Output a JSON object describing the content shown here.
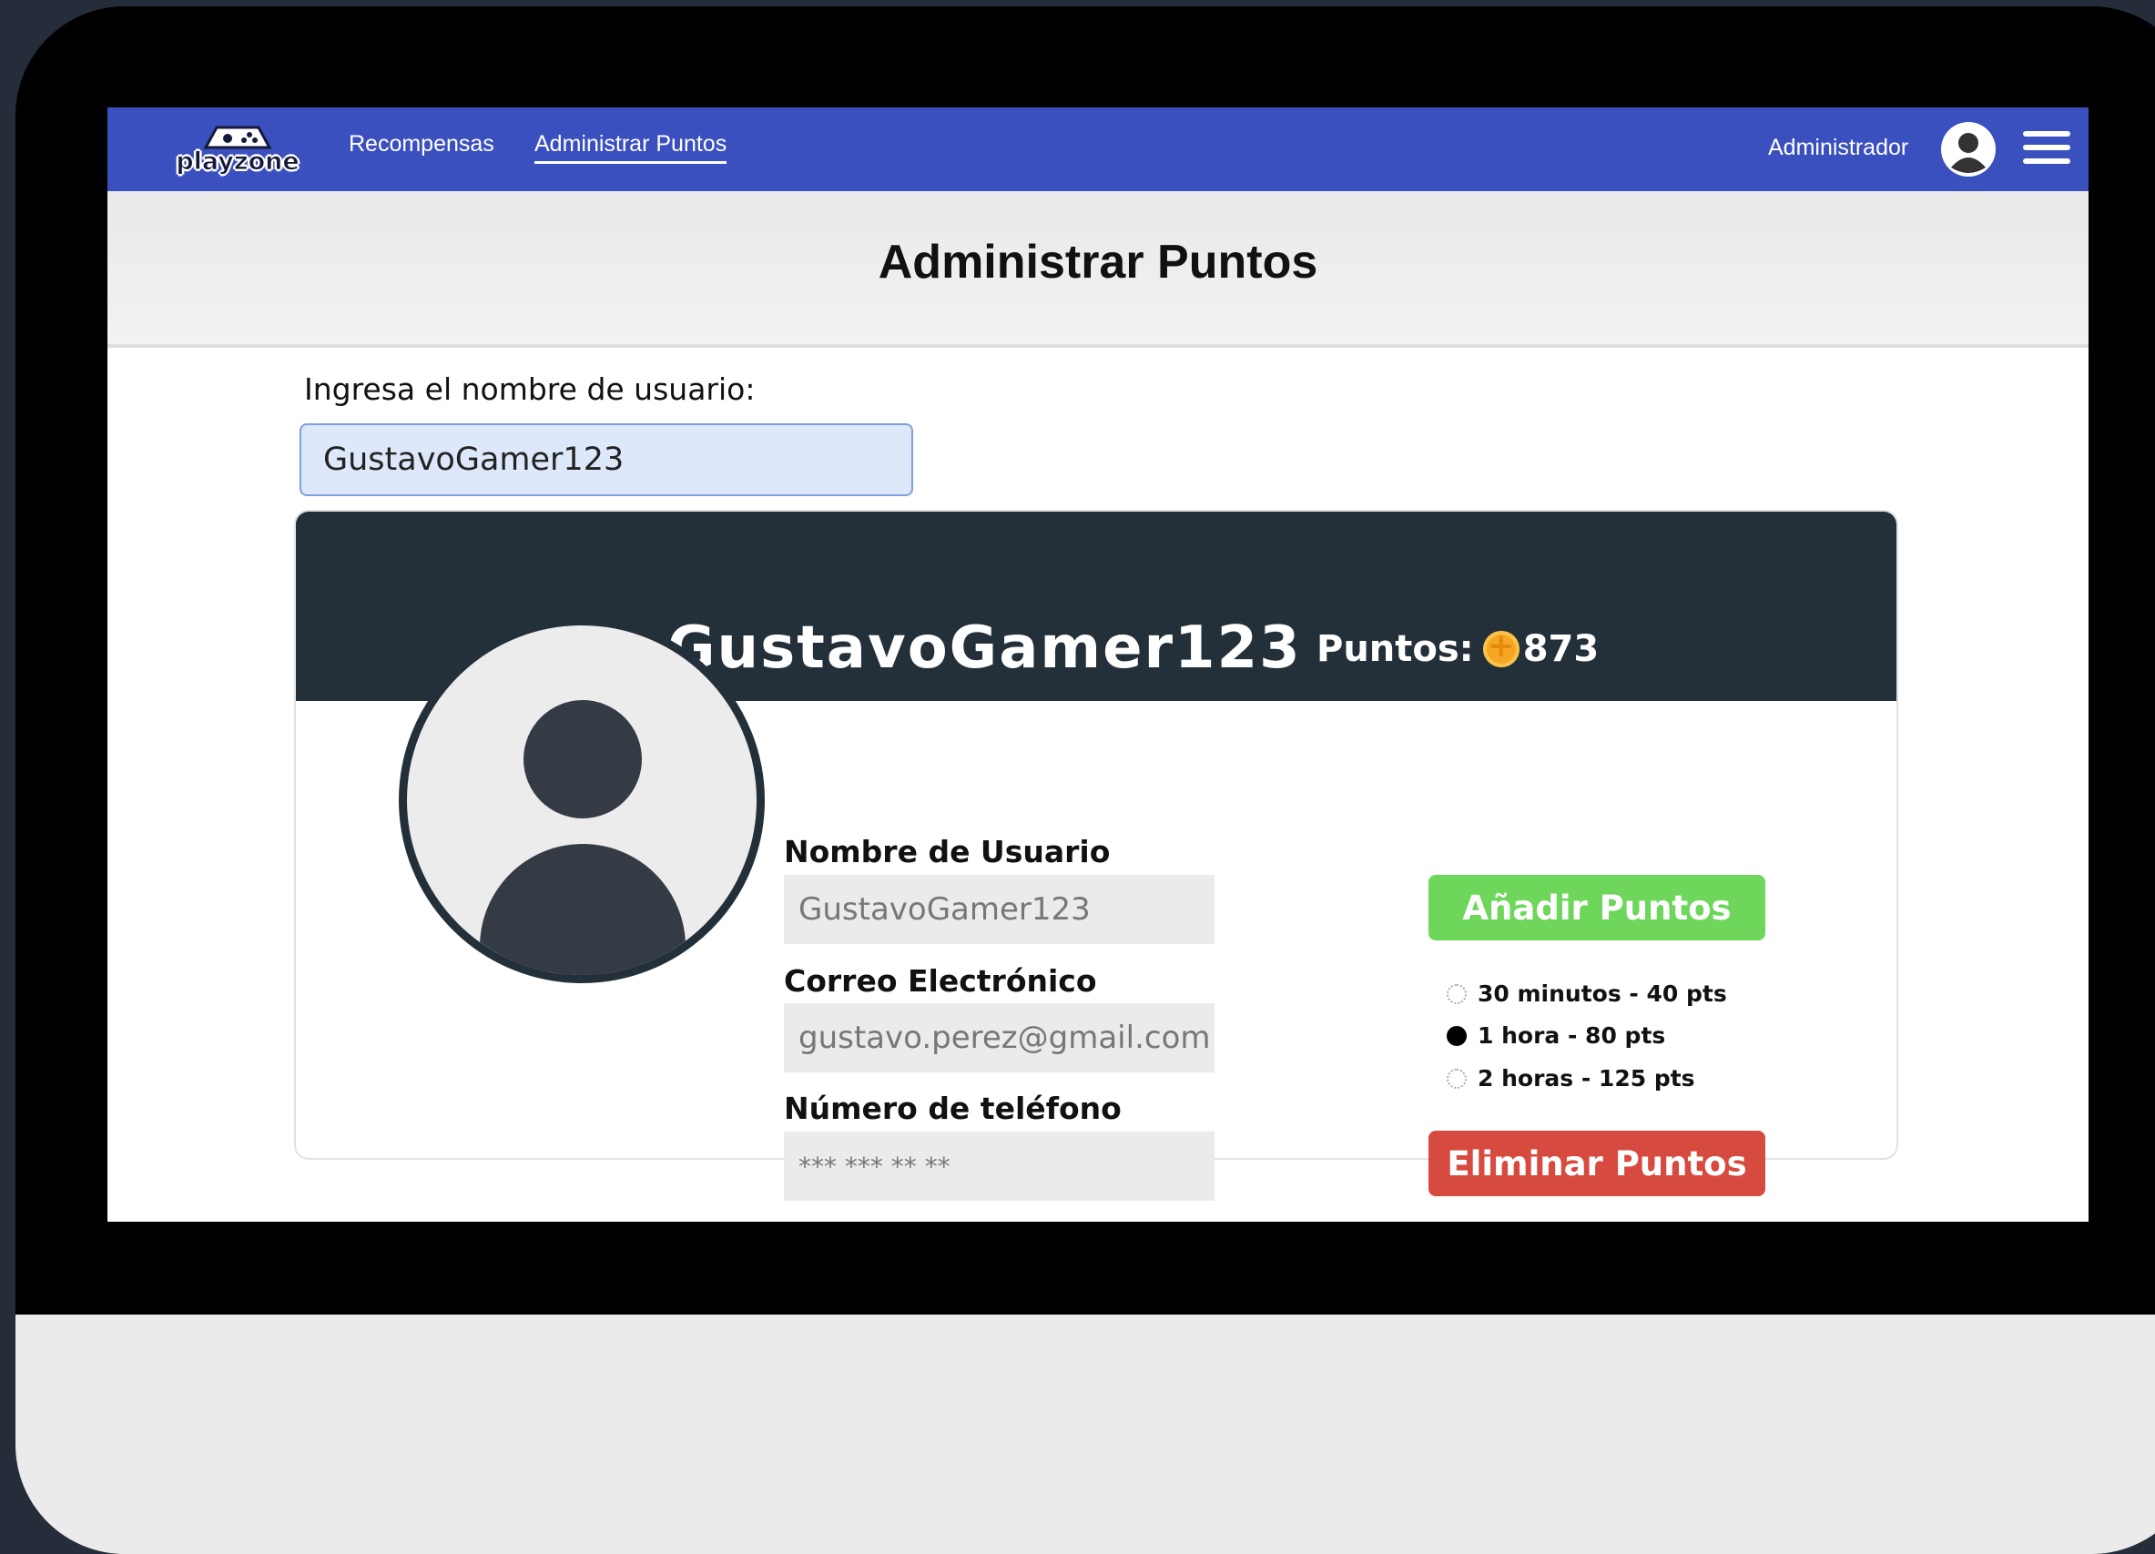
{
  "nav": {
    "logo_text": "playzone",
    "links": [
      "Recompensas",
      "Administrar Puntos"
    ],
    "active_link": "Administrar Puntos",
    "admin_label": "Administrador"
  },
  "page": {
    "title": "Administrar Puntos",
    "search_label": "Ingresa el nombre de usuario:",
    "search_value": "GustavoGamer123"
  },
  "profile": {
    "username": "GustavoGamer123",
    "points_label": "Puntos:",
    "points_value": "873",
    "fields": [
      {
        "label": "Nombre de Usuario",
        "value": "GustavoGamer123"
      },
      {
        "label": "Correo Electrónico",
        "value": "gustavo.perez@gmail.com"
      },
      {
        "label": "Número de teléfono",
        "value": "*** *** ** **"
      }
    ]
  },
  "actions": {
    "add_label": "Añadir Puntos",
    "remove_label": "Eliminar Puntos",
    "options": [
      {
        "label": "30 minutos - 40 pts",
        "selected": false
      },
      {
        "label": "1 hora - 80 pts",
        "selected": true
      },
      {
        "label": "2 horas - 125 pts",
        "selected": false
      }
    ]
  },
  "colors": {
    "navbar": "#3a50bf",
    "card_header": "#243039",
    "add_button": "#6ed65a",
    "remove_button": "#d64a40",
    "coin": "#f6a623"
  }
}
